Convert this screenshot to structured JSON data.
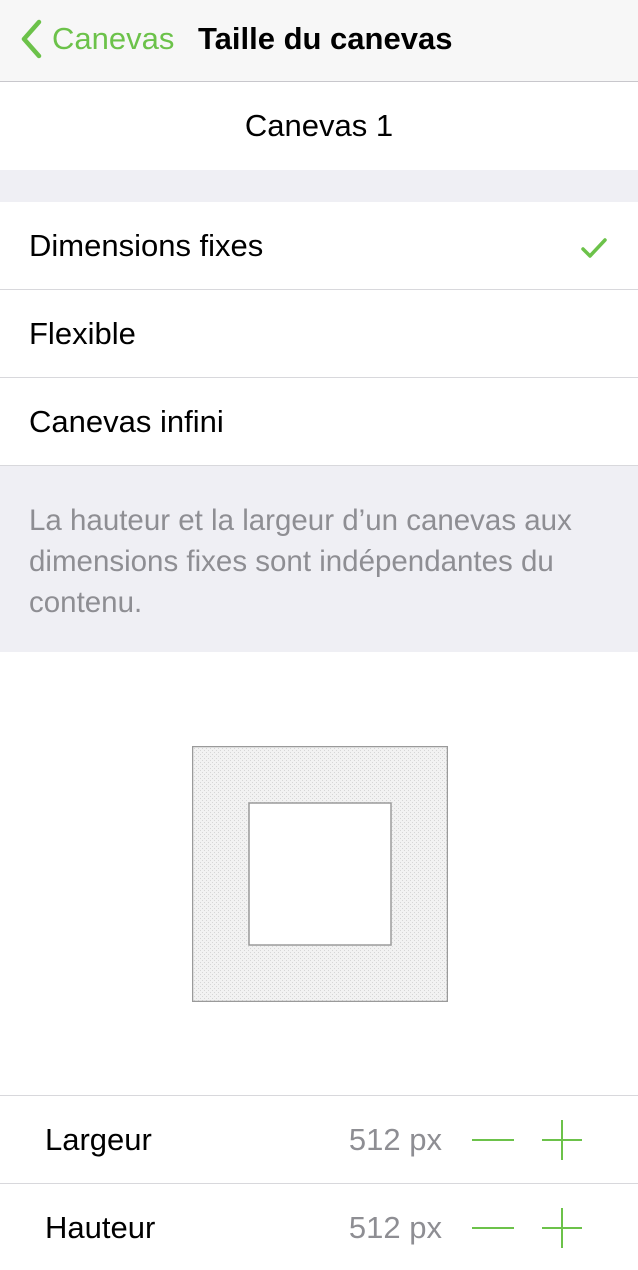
{
  "nav": {
    "back_label": "Canevas",
    "title": "Taille du canevas"
  },
  "canvas_name": "Canevas 1",
  "options": [
    {
      "label": "Dimensions fixes",
      "selected": true
    },
    {
      "label": "Flexible",
      "selected": false
    },
    {
      "label": "Canevas infini",
      "selected": false
    }
  ],
  "description": "La hauteur et la largeur d’un canevas aux dimensions fixes sont indépendantes du contenu.",
  "dimensions": {
    "width": {
      "label": "Largeur",
      "value": "512 px"
    },
    "height": {
      "label": "Hauteur",
      "value": "512 px"
    }
  },
  "colors": {
    "accent": "#6cc24a",
    "secondary_text": "#8e8e93",
    "group_background": "#efeff4"
  },
  "icons": {
    "back": "chevron-left-icon",
    "selected": "checkmark-icon",
    "decrement": "minus-icon",
    "increment": "plus-icon"
  }
}
